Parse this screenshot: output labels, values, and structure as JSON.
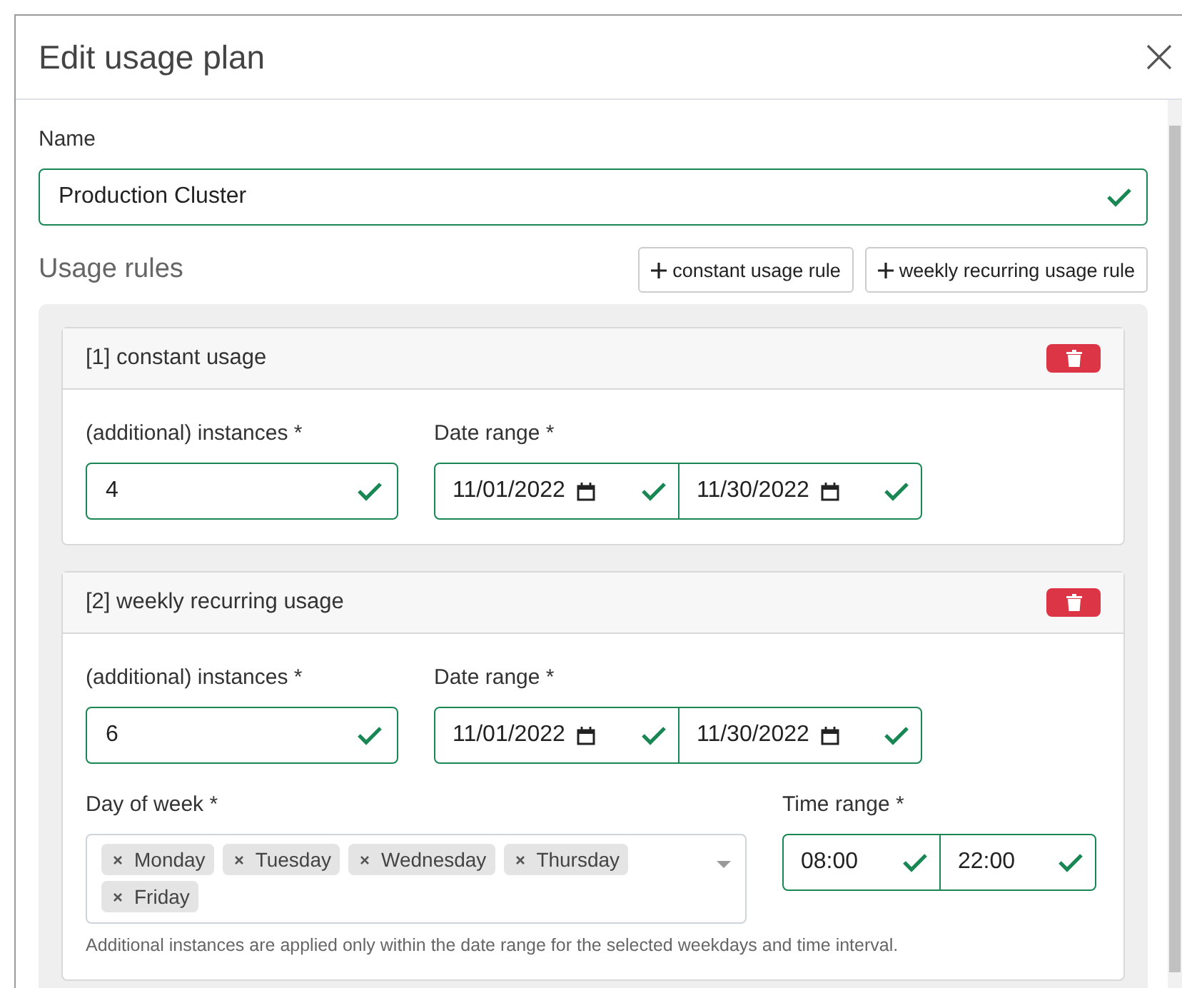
{
  "dialog": {
    "title": "Edit usage plan"
  },
  "name_field": {
    "label": "Name",
    "value": "Production Cluster",
    "valid": true
  },
  "usage_rules": {
    "heading": "Usage rules",
    "buttons": [
      "constant usage rule",
      "weekly recurring usage rule"
    ]
  },
  "rules": [
    {
      "kind": "constant",
      "title": "[1] constant usage",
      "instances": {
        "label": "(additional) instances *",
        "value": "4",
        "valid": true
      },
      "date_range": {
        "label": "Date range *",
        "from": "11/01/2022",
        "to": "11/30/2022",
        "valid": true
      }
    },
    {
      "kind": "weekly",
      "title": "[2] weekly recurring usage",
      "instances": {
        "label": "(additional) instances *",
        "value": "6",
        "valid": true
      },
      "date_range": {
        "label": "Date range *",
        "from": "11/01/2022",
        "to": "11/30/2022",
        "valid": true
      },
      "day_of_week": {
        "label": "Day of week *",
        "days": [
          "Monday",
          "Tuesday",
          "Wednesday",
          "Thursday",
          "Friday"
        ]
      },
      "time_range": {
        "label": "Time range *",
        "from": "08:00",
        "to": "22:00",
        "valid": true
      },
      "hint": "Additional instances are applied only within the date range for the selected weekdays and time interval."
    }
  ]
}
